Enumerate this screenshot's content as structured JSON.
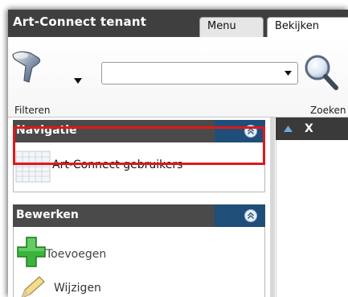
{
  "header": {
    "title": "Art-Connect tenant",
    "tabs": [
      {
        "label": "Menu",
        "active": false
      },
      {
        "label": "Bekijken",
        "active": true
      }
    ]
  },
  "ribbon": {
    "filter": {
      "label": "Filteren",
      "icon": "funnel-icon"
    },
    "search": {
      "value": "",
      "placeholder": "",
      "label": "Zoeken",
      "icon": "magnifier-icon"
    }
  },
  "navigation": {
    "title": "Navigatie",
    "items": [
      {
        "label": "Art-Connect gebruikers",
        "icon": "grid-table-icon"
      }
    ]
  },
  "edit": {
    "title": "Bewerken",
    "items": [
      {
        "label": "Toevoegen",
        "icon": "green-plus-icon",
        "highlighted": true
      },
      {
        "label": "Wijzigen",
        "icon": "pencil-icon",
        "highlighted": false
      }
    ]
  },
  "grid": {
    "column_label": "X"
  },
  "colors": {
    "header_bg": "#3f3f3f",
    "pane_header_accent": "#1f4f78",
    "highlight_border": "#e01818",
    "plus_green": "#3cb43c"
  }
}
